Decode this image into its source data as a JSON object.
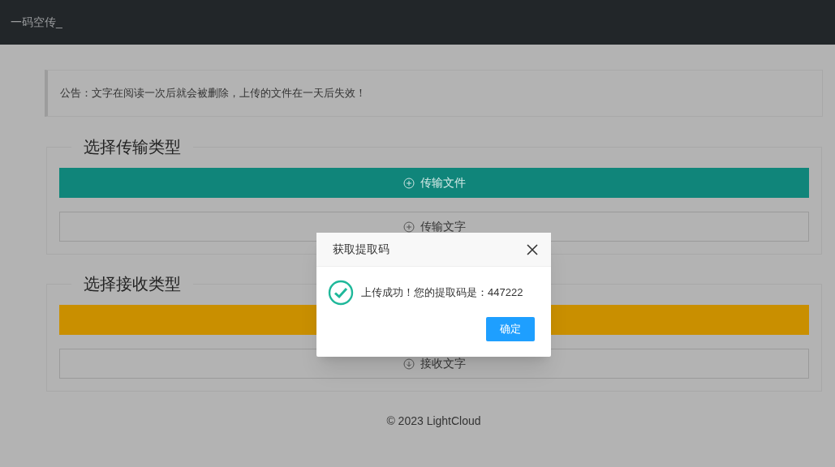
{
  "header": {
    "title": "一码空传_"
  },
  "notice": "公告：文字在阅读一次后就会被删除，上传的文件在一天后失效！",
  "sections": [
    {
      "legend": "选择传输类型",
      "buttons": [
        {
          "kind": "primary",
          "color": "#10857a",
          "label": "传输文件"
        },
        {
          "kind": "outline",
          "label": "传输文字"
        }
      ]
    },
    {
      "legend": "选择接收类型",
      "buttons": [
        {
          "kind": "primary",
          "color": "#c98f00"
        },
        {
          "kind": "outline",
          "label": "接收文字"
        }
      ]
    }
  ],
  "footer": "© 2023 LightCloud",
  "dialog": {
    "title": "获取提取码",
    "message": "上传成功！您的提取码是：447222",
    "button": "确定"
  }
}
